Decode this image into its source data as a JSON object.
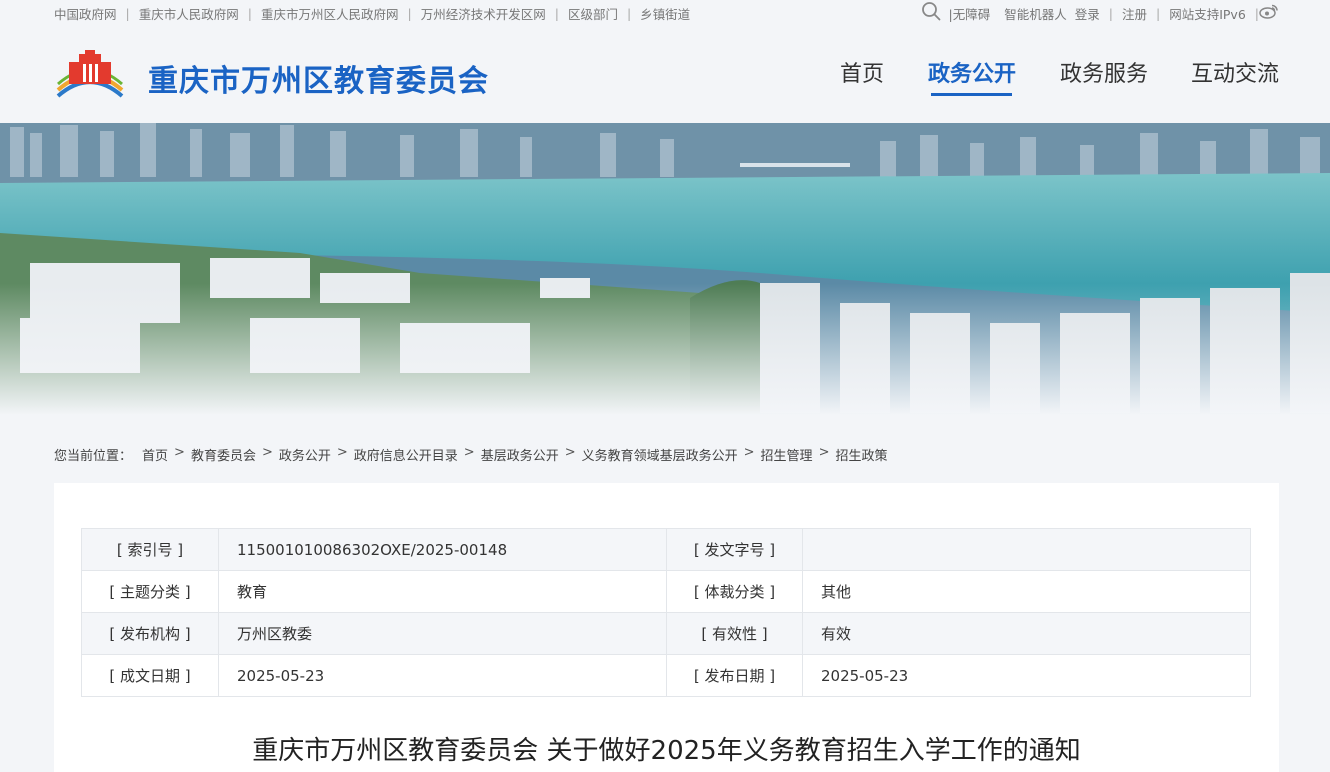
{
  "top_links": [
    "中国政府网",
    "重庆市人民政府网",
    "重庆市万州区人民政府网",
    "万州经济技术开发区网",
    "区级部门",
    "乡镇街道"
  ],
  "top_right": {
    "accessibility": "|无障碍",
    "robot": "智能机器人",
    "login": "登录",
    "register": "注册",
    "ipv6": "网站支持IPv6"
  },
  "site_title": "重庆市万州区教育委员会",
  "nav": [
    "首页",
    "政务公开",
    "政务服务",
    "互动交流"
  ],
  "nav_active": "政务公开",
  "breadcrumb": {
    "lead": "您当前位置：",
    "items": [
      "首页",
      "教育委员会",
      "政务公开",
      "政府信息公开目录",
      "基层政务公开",
      "义务教育领域基层政务公开",
      "招生管理",
      "招生政策"
    ]
  },
  "meta": {
    "index_label": "[ 索引号 ]",
    "index_value": "115001010086302OXE/2025-00148",
    "doc_no_label": "[ 发文字号 ]",
    "doc_no_value": "",
    "topic_label": "[ 主题分类 ]",
    "topic_value": "教育",
    "genre_label": "[ 体裁分类 ]",
    "genre_value": "其他",
    "org_label": "[ 发布机构 ]",
    "org_value": "万州区教委",
    "validity_label": "[ 有效性 ]",
    "validity_value": "有效",
    "written_label": "[ 成文日期 ]",
    "written_value": "2025-05-23",
    "publish_label": "[ 发布日期 ]",
    "publish_value": "2025-05-23"
  },
  "doc_title": "重庆市万州区教育委员会 关于做好2025年义务教育招生入学工作的通知",
  "colors": {
    "brand": "#1a63c4",
    "page_bg": "#f3f5f8"
  },
  "icons": [
    "search-icon",
    "weibo-icon",
    "logo-emblem"
  ]
}
